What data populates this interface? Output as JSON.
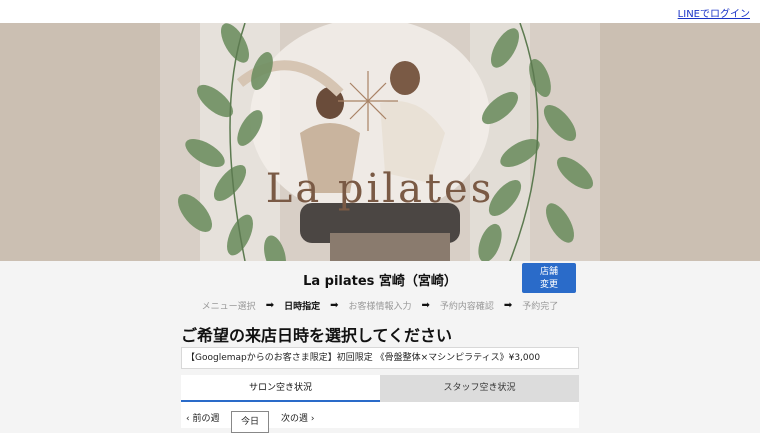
{
  "header": {
    "login_link": "LINEでログイン"
  },
  "hero": {
    "logo_text": "La pilates"
  },
  "store": {
    "title": "La pilates 宮崎（宮崎）",
    "change_button": "店舗\n変更"
  },
  "steps": [
    {
      "label": "メニュー選択",
      "active": false
    },
    {
      "label": "日時指定",
      "active": true
    },
    {
      "label": "お客様情報入力",
      "active": false
    },
    {
      "label": "予約内容確認",
      "active": false
    },
    {
      "label": "予約完了",
      "active": false
    }
  ],
  "main": {
    "heading": "ご希望の来店日時を選択してください",
    "selected_menu": "【Googlemapからのお客さま限定】初回限定 《骨盤整体×マシンピラティス》¥3,000",
    "tabs": [
      {
        "label": "サロン空き状況",
        "active": true
      },
      {
        "label": "スタッフ空き状況",
        "active": false
      }
    ],
    "nav": {
      "prev": "前の週",
      "today": "今日",
      "next": "次の週"
    }
  },
  "colors": {
    "accent": "#2a6bc9",
    "hero_bg": "#cbbfb2",
    "logo": "#7a5a45",
    "leaf": "#6f8f62"
  }
}
